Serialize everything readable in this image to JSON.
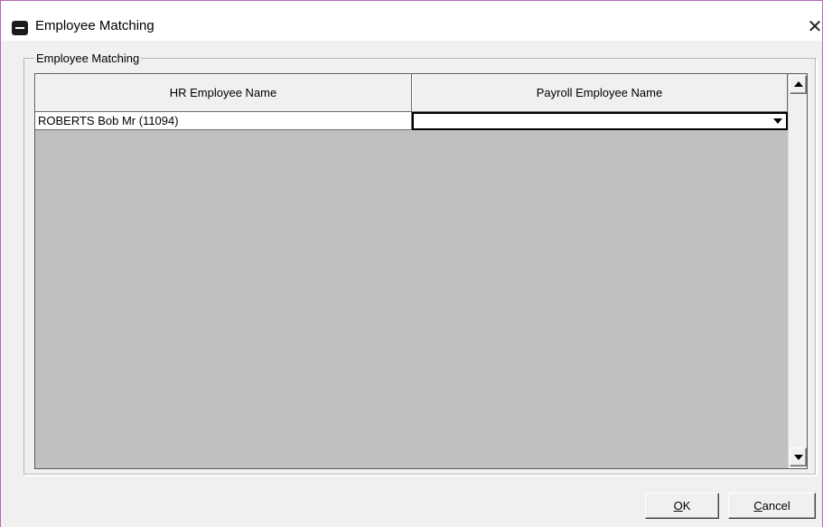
{
  "window": {
    "title": "Employee Matching",
    "close_glyph": "✕"
  },
  "group": {
    "legend": "Employee Matching"
  },
  "grid": {
    "columns": [
      "HR Employee Name",
      "Payroll Employee Name"
    ],
    "rows": [
      {
        "hr_name": "ROBERTS Bob Mr (11094)",
        "payroll_name": ""
      }
    ]
  },
  "buttons": {
    "ok_mnemonic": "O",
    "ok_rest": "K",
    "cancel_mnemonic": "C",
    "cancel_rest": "ancel"
  },
  "icons": {
    "app": "app-logo-icon",
    "close": "close-icon",
    "combo": "chevron-down-icon",
    "scroll_up": "scroll-up-arrow-icon",
    "scroll_down": "scroll-down-arrow-icon"
  },
  "colors": {
    "grid_background": "#c0c0c0",
    "window_border": "#b06ab3"
  }
}
